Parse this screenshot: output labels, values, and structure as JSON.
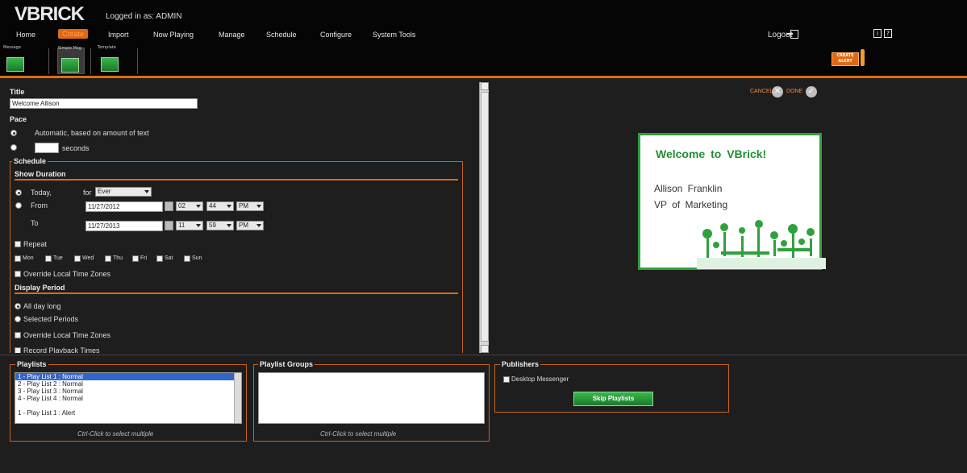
{
  "brand": {
    "logo": "VBRICK",
    "logged_in_as": "Logged in as: ADMIN"
  },
  "nav": {
    "items": [
      {
        "label": "Home"
      },
      {
        "label": "Create",
        "active": true
      },
      {
        "label": "Import"
      },
      {
        "label": "Now Playing"
      },
      {
        "label": "Manage"
      },
      {
        "label": "Schedule"
      },
      {
        "label": "Configure"
      },
      {
        "label": "System Tools"
      }
    ],
    "logout": "Logout",
    "help_icons": [
      "i",
      "?"
    ]
  },
  "toolbar": {
    "tools": [
      {
        "label": "Message",
        "icon": "message-icon"
      },
      {
        "label": "Simple Msg",
        "icon": "simple-message-icon",
        "selected": true
      },
      {
        "label": "Template",
        "icon": "template-icon"
      }
    ],
    "alert_label": "CREATE ALERT"
  },
  "form": {
    "title_label": "Title",
    "title_value": "Welcome Allison",
    "pace_label": "Pace",
    "pace_auto": "Automatic, based on amount of text",
    "pace_seconds_value": "",
    "pace_seconds": "seconds",
    "schedule_legend": "Schedule",
    "show_duration": "Show Duration",
    "today": "Today,",
    "for": "for",
    "for_value": "Ever",
    "from": "From",
    "from_date": "11/27/2012",
    "from_hour": "02",
    "from_min": "44",
    "from_ampm": "PM",
    "to": "To",
    "to_date": "11/27/2013",
    "to_hour": "11",
    "to_min": "59",
    "to_ampm": "PM",
    "repeat": "Repeat",
    "days": [
      "Mon",
      "Tue",
      "Wed",
      "Thu",
      "Fri",
      "Sat",
      "Sun"
    ],
    "override_tz": "Override Local Time Zones",
    "display_period": "Display Period",
    "all_day": "All day long",
    "selected_periods": "Selected Periods",
    "override_tz2": "Override Local Time Zones",
    "record_playback": "Record Playback Times"
  },
  "preview": {
    "cancel": "CANCEL",
    "done": "DONE",
    "slide_title": "Welcome to VBrick!",
    "slide_line1": "Allison Franklin",
    "slide_line2": "VP of Marketing"
  },
  "bottom": {
    "playlists_legend": "Playlists",
    "playlists": [
      {
        "label": "1 - Play List 1 : Normal",
        "selected": true
      },
      {
        "label": "2 - Play List 2 : Normal"
      },
      {
        "label": "3 - Play List 3 : Normal"
      },
      {
        "label": "4 - Play List 4 : Normal"
      },
      {
        "label": ""
      },
      {
        "label": "1 - Play List 1 : Alert"
      }
    ],
    "playlists_hint": "Ctrl-Click to select multiple",
    "groups_legend": "Playlist Groups",
    "groups_hint": "Ctrl-Click to select multiple",
    "publishers_legend": "Publishers",
    "desktop_messenger": "Desktop Messenger",
    "skip_playlists": "Skip Playlists"
  },
  "colors": {
    "accent": "#e06a12",
    "green": "#2fa13f",
    "background": "#1e1e1e"
  }
}
